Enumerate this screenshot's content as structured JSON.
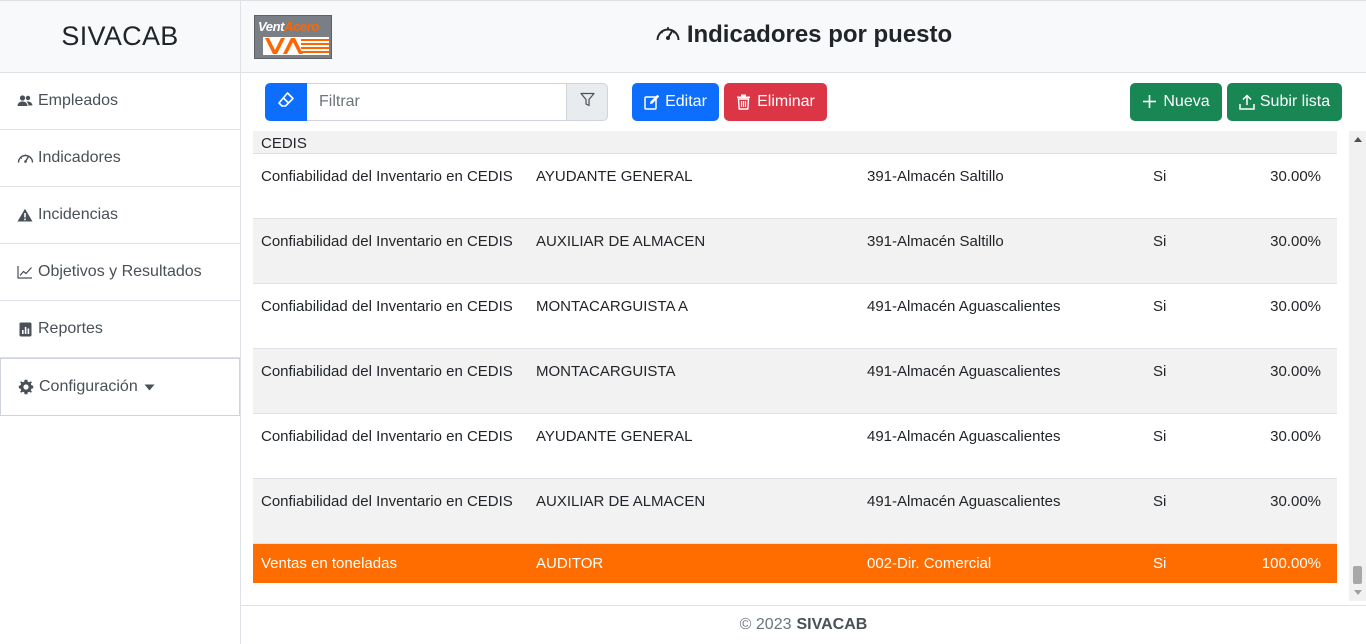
{
  "app": {
    "brand": "SIVACAB"
  },
  "logo": {
    "text_light": "Vent",
    "text_bold": "Acero"
  },
  "header": {
    "title": "Indicadores por puesto",
    "title_icon": "speedometer-icon"
  },
  "sidebar": {
    "items": [
      {
        "label": "Empleados",
        "icon": "people-icon"
      },
      {
        "label": "Indicadores",
        "icon": "speedometer-icon"
      },
      {
        "label": "Incidencias",
        "icon": "warning-triangle-icon"
      },
      {
        "label": "Objetivos y Resultados",
        "icon": "line-chart-icon"
      },
      {
        "label": "Reportes",
        "icon": "report-chart-icon"
      },
      {
        "label": "Configuración",
        "icon": "gear-icon"
      }
    ]
  },
  "toolbar": {
    "filter_placeholder": "Filtrar",
    "edit_label": "Editar",
    "delete_label": "Eliminar",
    "new_label": "Nueva",
    "upload_label": "Subir lista"
  },
  "table": {
    "partial_row_text": "CEDIS",
    "rows": [
      {
        "indicador": "Confiabilidad del Inventario en CEDIS",
        "puesto": "AYUDANTE GENERAL",
        "ubicacion": "391-Almacén Saltillo",
        "activo": "Si",
        "peso": "30.00%",
        "selected": false
      },
      {
        "indicador": "Confiabilidad del Inventario en CEDIS",
        "puesto": "AUXILIAR DE ALMACEN",
        "ubicacion": "391-Almacén Saltillo",
        "activo": "Si",
        "peso": "30.00%",
        "selected": false
      },
      {
        "indicador": "Confiabilidad del Inventario en CEDIS",
        "puesto": "MONTACARGUISTA A",
        "ubicacion": "491-Almacén Aguascalientes",
        "activo": "Si",
        "peso": "30.00%",
        "selected": false
      },
      {
        "indicador": "Confiabilidad del Inventario en CEDIS",
        "puesto": "MONTACARGUISTA",
        "ubicacion": "491-Almacén Aguascalientes",
        "activo": "Si",
        "peso": "30.00%",
        "selected": false
      },
      {
        "indicador": "Confiabilidad del Inventario en CEDIS",
        "puesto": "AYUDANTE GENERAL",
        "ubicacion": "491-Almacén Aguascalientes",
        "activo": "Si",
        "peso": "30.00%",
        "selected": false
      },
      {
        "indicador": "Confiabilidad del Inventario en CEDIS",
        "puesto": "AUXILIAR DE ALMACEN",
        "ubicacion": "491-Almacén Aguascalientes",
        "activo": "Si",
        "peso": "30.00%",
        "selected": false
      },
      {
        "indicador": "Ventas en toneladas",
        "puesto": "AUDITOR",
        "ubicacion": "002-Dir. Comercial",
        "activo": "Si",
        "peso": "100.00%",
        "selected": true
      }
    ]
  },
  "footer": {
    "copyright": "© 2023",
    "brand": "SIVACAB"
  },
  "colors": {
    "primary": "#0d6efd",
    "danger": "#dc3545",
    "success": "#198754",
    "selected_row": "#ff6c00"
  }
}
